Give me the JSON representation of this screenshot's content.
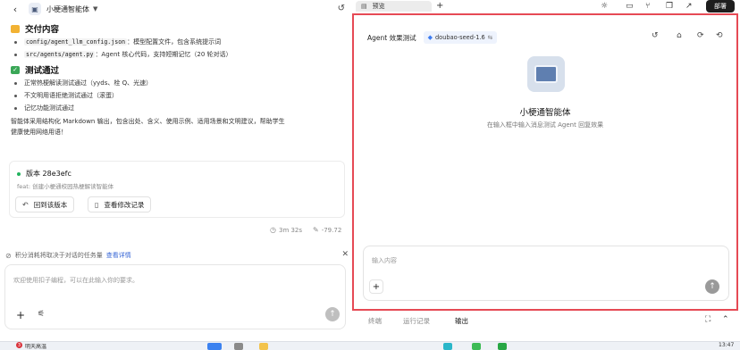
{
  "left": {
    "agent_name": "小梗通智能体",
    "sections": [
      {
        "title": "交付内容",
        "items": [
          {
            "code": "config/agent_llm_config.json",
            "text": "：模型配置文件，包含系统提示词"
          },
          {
            "code": "src/agents/agent.py",
            "text": "：Agent 核心代码，支持短期记忆（20 轮对话）"
          }
        ]
      },
      {
        "title": "测试通过",
        "items": [
          {
            "text": "正常热梗解读测试通过（yyds、栓 Q、光速）"
          },
          {
            "text": "不文明用语拒绝测试通过（滚蛋）"
          },
          {
            "text": "记忆功能测试通过"
          }
        ]
      }
    ],
    "summary_line1": "智能体采用结构化 Markdown 输出，包含出处、含义、使用示例、适用场景和文明建议，帮助学生",
    "summary_line2": "健康使用网络用语！",
    "version": {
      "title": "版本 28e3efc",
      "subtitle": "feat: 创建小梗通校园热梗解读智能体",
      "rollback_label": "回到该版本",
      "view_changes_label": "查看修改记录"
    },
    "stats": {
      "duration": "3m 32s",
      "credits": "-79.72"
    },
    "notice": {
      "text": "积分消耗将取决于对话的任务量",
      "link": "查看详情"
    },
    "input": {
      "placeholder": "欢迎使用扣子编程，可以在此输入你的要求。"
    }
  },
  "right": {
    "tab_label": "预览",
    "deploy_label": "部署",
    "panel_title": "Agent 效果测试",
    "model_name": "doubao-seed-1.6",
    "agent_name": "小梗通智能体",
    "agent_desc": "在输入框中输入消息测试 Agent 回复效果",
    "input_placeholder": "输入内容",
    "bottom_tabs": [
      "终端",
      "运行记录",
      "输出"
    ],
    "active_bottom_tab": "输出"
  },
  "taskbar": {
    "weather_badge": "3",
    "weather_text": "明天高温",
    "clock": "13:47"
  },
  "colors": {
    "highlight_border": "#e64a55",
    "accent_link": "#3867d6",
    "deploy_bg": "#1e1e1e",
    "status_green": "#22b35e"
  }
}
